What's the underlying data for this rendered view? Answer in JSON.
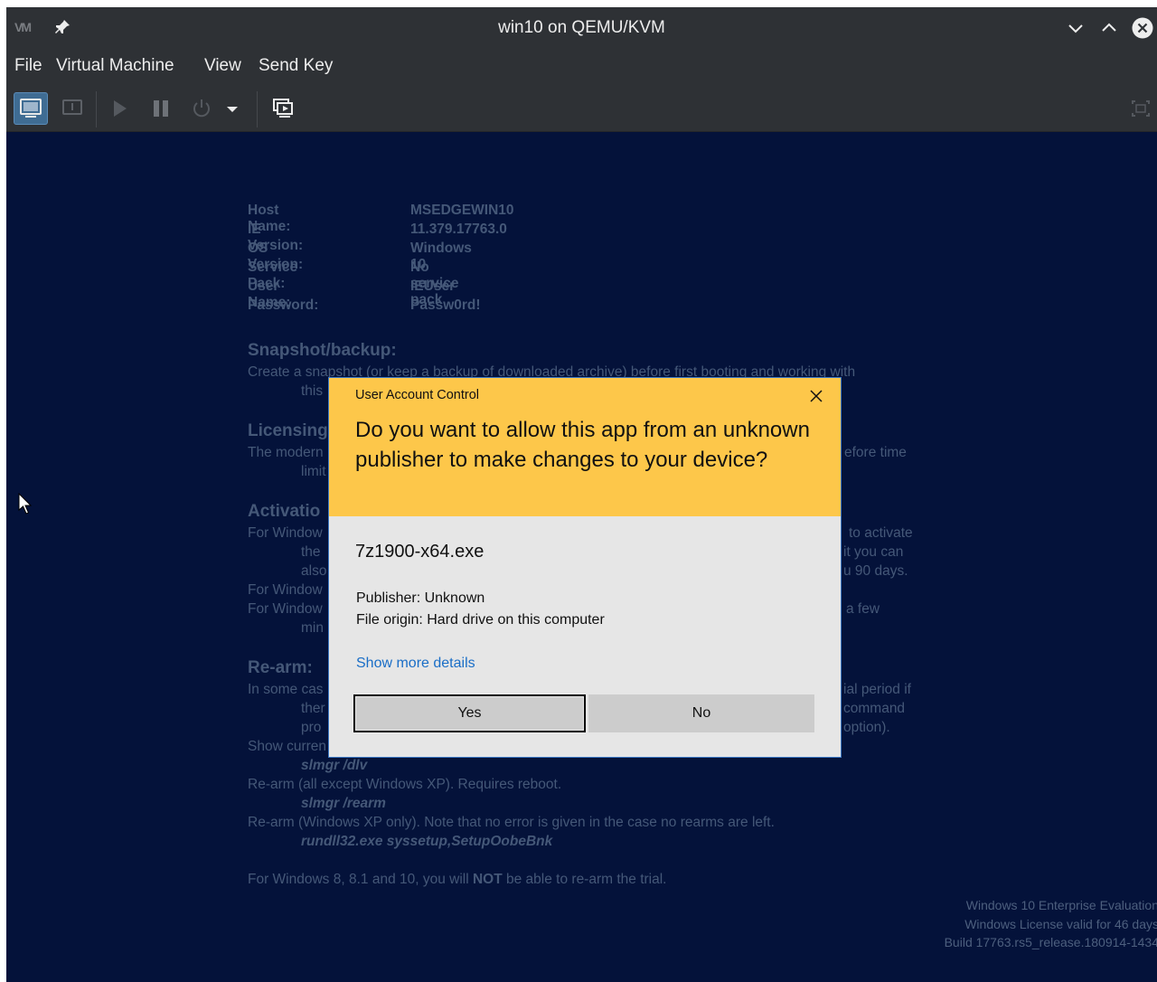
{
  "window": {
    "title": "win10 on QEMU/KVM",
    "logo_text": "VM"
  },
  "menu": {
    "items": [
      "File",
      "Virtual Machine",
      "View",
      "Send Key"
    ]
  },
  "toolbar": {
    "icons": [
      "console-icon",
      "details-icon",
      "run-icon",
      "pause-icon",
      "power-icon",
      "dropdown-icon",
      "snapshots-icon",
      "fullscreen-icon"
    ]
  },
  "guest": {
    "info_labels": [
      "Host Name:",
      "IE Version:",
      "OS Version:",
      "Service Pack:",
      "User Name:",
      "Password:"
    ],
    "info_values": [
      "MSEDGEWIN10",
      "11.379.17763.0",
      "Windows 10",
      "No service pack",
      "IEUser",
      "Passw0rd!"
    ],
    "snapshot_heading": "Snapshot/backup:",
    "snapshot_line1": "Create a snapshot (or keep a backup of downloaded archive) before first booting and working with",
    "snapshot_line2": "this",
    "licensing_heading": "Licensing",
    "licensing_line1_left": "The modern",
    "licensing_line1_right": "efore time",
    "licensing_line2_left": "limit",
    "activation_heading": "Activatio",
    "act_l1_left": "For Window",
    "act_l1_right": "to activate",
    "act_l2_left": "the",
    "act_l2_right": "it you can",
    "act_l3_left": "also",
    "act_l3_right": "u 90 days.",
    "act_l4_left": "For Window",
    "act_l5_left": "For Window",
    "act_l5_right": "a few",
    "act_l6_left": "min",
    "rearm_heading": "Re-arm:",
    "re_l1_left": "In some cas",
    "re_l1_right": "ial period if",
    "re_l2_left": "ther",
    "re_l2_right": "command",
    "re_l3_left": "pro",
    "re_l3_right": "option).",
    "re_l4_left": "Show curren",
    "cmd1": "slmgr /dlv",
    "re_line5": "Re-arm (all except Windows XP). Requires reboot.",
    "cmd2": "slmgr /rearm",
    "re_line6": "Re-arm (Windows XP only). Note that no error is given in the case no rearms are left.",
    "cmd3": "rundll32.exe syssetup,SetupOobeBnk",
    "final_pre": "For Windows 8, 8.1 and 10, you will ",
    "final_bold": "NOT",
    "final_post": " be able to re-arm the trial.",
    "watermark": [
      "Windows 10 Enterprise Evaluation",
      "Windows License valid for 46 days",
      "Build 17763.rs5_release.180914-1434"
    ]
  },
  "uac": {
    "caption": "User Account Control",
    "question": "Do you want to allow this app from an unknown publisher to make changes to your device?",
    "app_name": "7z1900-x64.exe",
    "publisher": "Publisher: Unknown",
    "origin": "File origin: Hard drive on this computer",
    "more_link": "Show more details",
    "yes_label": "Yes",
    "no_label": "No",
    "accent": "#fdc74a"
  }
}
